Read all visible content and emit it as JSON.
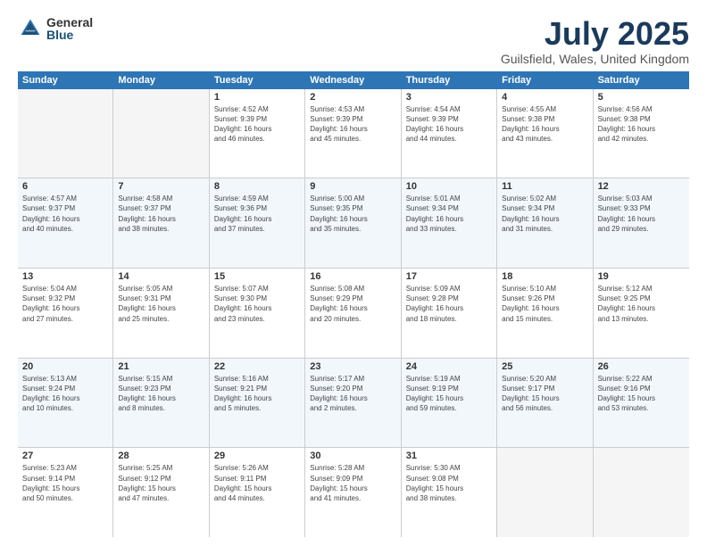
{
  "logo": {
    "general": "General",
    "blue": "Blue"
  },
  "title": "July 2025",
  "subtitle": "Guilsfield, Wales, United Kingdom",
  "header_days": [
    "Sunday",
    "Monday",
    "Tuesday",
    "Wednesday",
    "Thursday",
    "Friday",
    "Saturday"
  ],
  "weeks": [
    [
      {
        "day": "",
        "empty": true
      },
      {
        "day": "",
        "empty": true
      },
      {
        "day": "1",
        "info": "Sunrise: 4:52 AM\nSunset: 9:39 PM\nDaylight: 16 hours\nand 46 minutes."
      },
      {
        "day": "2",
        "info": "Sunrise: 4:53 AM\nSunset: 9:39 PM\nDaylight: 16 hours\nand 45 minutes."
      },
      {
        "day": "3",
        "info": "Sunrise: 4:54 AM\nSunset: 9:39 PM\nDaylight: 16 hours\nand 44 minutes."
      },
      {
        "day": "4",
        "info": "Sunrise: 4:55 AM\nSunset: 9:38 PM\nDaylight: 16 hours\nand 43 minutes."
      },
      {
        "day": "5",
        "info": "Sunrise: 4:56 AM\nSunset: 9:38 PM\nDaylight: 16 hours\nand 42 minutes."
      }
    ],
    [
      {
        "day": "6",
        "info": "Sunrise: 4:57 AM\nSunset: 9:37 PM\nDaylight: 16 hours\nand 40 minutes."
      },
      {
        "day": "7",
        "info": "Sunrise: 4:58 AM\nSunset: 9:37 PM\nDaylight: 16 hours\nand 38 minutes."
      },
      {
        "day": "8",
        "info": "Sunrise: 4:59 AM\nSunset: 9:36 PM\nDaylight: 16 hours\nand 37 minutes."
      },
      {
        "day": "9",
        "info": "Sunrise: 5:00 AM\nSunset: 9:35 PM\nDaylight: 16 hours\nand 35 minutes."
      },
      {
        "day": "10",
        "info": "Sunrise: 5:01 AM\nSunset: 9:34 PM\nDaylight: 16 hours\nand 33 minutes."
      },
      {
        "day": "11",
        "info": "Sunrise: 5:02 AM\nSunset: 9:34 PM\nDaylight: 16 hours\nand 31 minutes."
      },
      {
        "day": "12",
        "info": "Sunrise: 5:03 AM\nSunset: 9:33 PM\nDaylight: 16 hours\nand 29 minutes."
      }
    ],
    [
      {
        "day": "13",
        "info": "Sunrise: 5:04 AM\nSunset: 9:32 PM\nDaylight: 16 hours\nand 27 minutes."
      },
      {
        "day": "14",
        "info": "Sunrise: 5:05 AM\nSunset: 9:31 PM\nDaylight: 16 hours\nand 25 minutes."
      },
      {
        "day": "15",
        "info": "Sunrise: 5:07 AM\nSunset: 9:30 PM\nDaylight: 16 hours\nand 23 minutes."
      },
      {
        "day": "16",
        "info": "Sunrise: 5:08 AM\nSunset: 9:29 PM\nDaylight: 16 hours\nand 20 minutes."
      },
      {
        "day": "17",
        "info": "Sunrise: 5:09 AM\nSunset: 9:28 PM\nDaylight: 16 hours\nand 18 minutes."
      },
      {
        "day": "18",
        "info": "Sunrise: 5:10 AM\nSunset: 9:26 PM\nDaylight: 16 hours\nand 15 minutes."
      },
      {
        "day": "19",
        "info": "Sunrise: 5:12 AM\nSunset: 9:25 PM\nDaylight: 16 hours\nand 13 minutes."
      }
    ],
    [
      {
        "day": "20",
        "info": "Sunrise: 5:13 AM\nSunset: 9:24 PM\nDaylight: 16 hours\nand 10 minutes."
      },
      {
        "day": "21",
        "info": "Sunrise: 5:15 AM\nSunset: 9:23 PM\nDaylight: 16 hours\nand 8 minutes."
      },
      {
        "day": "22",
        "info": "Sunrise: 5:16 AM\nSunset: 9:21 PM\nDaylight: 16 hours\nand 5 minutes."
      },
      {
        "day": "23",
        "info": "Sunrise: 5:17 AM\nSunset: 9:20 PM\nDaylight: 16 hours\nand 2 minutes."
      },
      {
        "day": "24",
        "info": "Sunrise: 5:19 AM\nSunset: 9:19 PM\nDaylight: 15 hours\nand 59 minutes."
      },
      {
        "day": "25",
        "info": "Sunrise: 5:20 AM\nSunset: 9:17 PM\nDaylight: 15 hours\nand 56 minutes."
      },
      {
        "day": "26",
        "info": "Sunrise: 5:22 AM\nSunset: 9:16 PM\nDaylight: 15 hours\nand 53 minutes."
      }
    ],
    [
      {
        "day": "27",
        "info": "Sunrise: 5:23 AM\nSunset: 9:14 PM\nDaylight: 15 hours\nand 50 minutes."
      },
      {
        "day": "28",
        "info": "Sunrise: 5:25 AM\nSunset: 9:12 PM\nDaylight: 15 hours\nand 47 minutes."
      },
      {
        "day": "29",
        "info": "Sunrise: 5:26 AM\nSunset: 9:11 PM\nDaylight: 15 hours\nand 44 minutes."
      },
      {
        "day": "30",
        "info": "Sunrise: 5:28 AM\nSunset: 9:09 PM\nDaylight: 15 hours\nand 41 minutes."
      },
      {
        "day": "31",
        "info": "Sunrise: 5:30 AM\nSunset: 9:08 PM\nDaylight: 15 hours\nand 38 minutes."
      },
      {
        "day": "",
        "empty": true
      },
      {
        "day": "",
        "empty": true
      }
    ]
  ]
}
